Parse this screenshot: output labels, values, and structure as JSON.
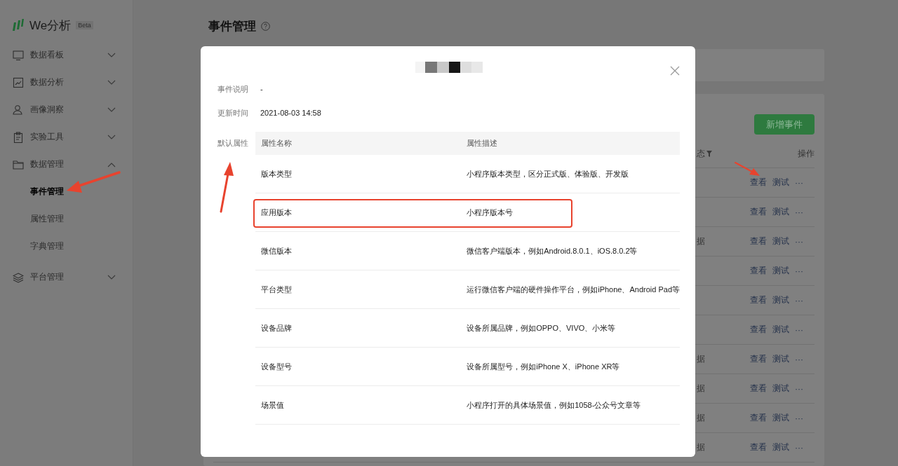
{
  "sidebar": {
    "logo": "We分析",
    "badge": "Beta",
    "items": [
      {
        "label": "数据看板",
        "expanded": false
      },
      {
        "label": "数据分析",
        "expanded": false
      },
      {
        "label": "画像洞察",
        "expanded": false
      },
      {
        "label": "实验工具",
        "expanded": false
      },
      {
        "label": "数据管理",
        "expanded": true,
        "children": [
          {
            "label": "事件管理",
            "selected": true
          },
          {
            "label": "属性管理",
            "selected": false
          },
          {
            "label": "字典管理",
            "selected": false
          }
        ]
      },
      {
        "label": "平台管理",
        "expanded": false
      }
    ]
  },
  "page": {
    "title": "事件管理",
    "new_button": "新增事件",
    "table": {
      "columns": [
        "态",
        "操作"
      ],
      "rows": [
        {
          "actions": [
            "查看",
            "测试",
            "···"
          ]
        },
        {
          "actions": [
            "查看",
            "测试",
            "···"
          ]
        },
        {
          "column_1": "据",
          "actions": [
            "查看",
            "测试",
            "···"
          ]
        },
        {
          "actions": [
            "查看",
            "测试",
            "···"
          ]
        },
        {
          "actions": [
            "查看",
            "测试",
            "···"
          ]
        },
        {
          "actions": [
            "查看",
            "测试",
            "···"
          ]
        },
        {
          "column_1": "据",
          "actions": [
            "查看",
            "测试",
            "···"
          ]
        },
        {
          "column_1": "据",
          "actions": [
            "查看",
            "测试",
            "···"
          ]
        },
        {
          "column_1": "据",
          "actions": [
            "查看",
            "测试",
            "···"
          ]
        },
        {
          "column_1": "据",
          "actions": [
            "查看",
            "测试",
            "···"
          ]
        }
      ]
    }
  },
  "modal": {
    "fields": [
      {
        "label": "事件说明",
        "value": "-"
      },
      {
        "label": "更新时间",
        "value": "2021-08-03 14:58"
      }
    ],
    "attributes": {
      "label": "默认属性",
      "columns": [
        "属性名称",
        "属性描述"
      ],
      "rows": [
        {
          "name": "版本类型",
          "description": "小程序版本类型，区分正式版、体验版、开发版",
          "highlighted": false
        },
        {
          "name": "应用版本",
          "description": "小程序版本号",
          "highlighted": true
        },
        {
          "name": "微信版本",
          "description": "微信客户端版本，例如Android.8.0.1、iOS.8.0.2等",
          "highlighted": false
        },
        {
          "name": "平台类型",
          "description": "运行微信客户端的硬件操作平台，例如iPhone、Android Pad等",
          "highlighted": false
        },
        {
          "name": "设备品牌",
          "description": "设备所属品牌，例如OPPO、VIVO、小米等",
          "highlighted": false
        },
        {
          "name": "设备型号",
          "description": "设备所属型号，例如iPhone X、iPhone XR等",
          "highlighted": false
        },
        {
          "name": "场景值",
          "description": "小程序打开的具体场景值，例如1058-公众号文章等",
          "highlighted": false
        }
      ]
    }
  }
}
